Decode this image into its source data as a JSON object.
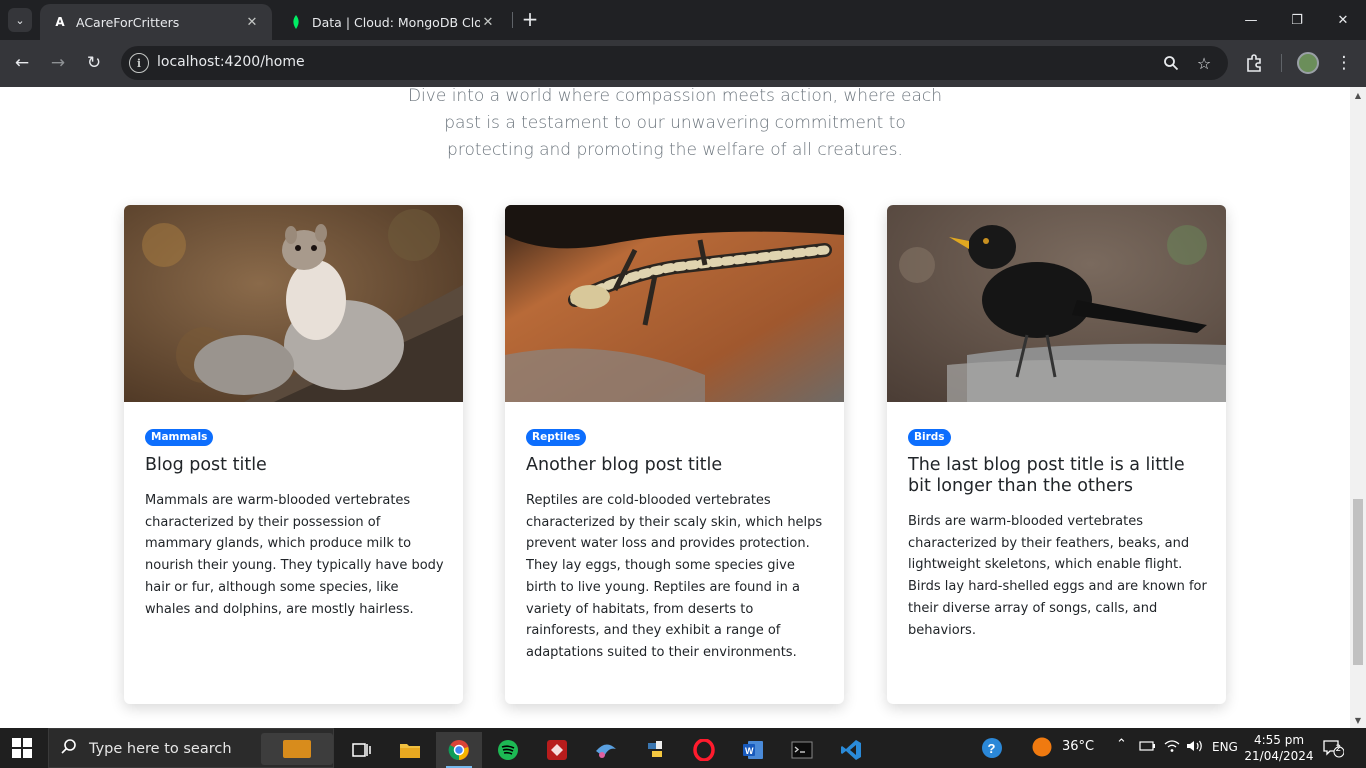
{
  "browser": {
    "tabs": [
      {
        "title": "ACareForCritters",
        "active": true
      },
      {
        "title": "Data | Cloud: MongoDB Cloud",
        "active": false
      }
    ],
    "url": "localhost:4200/home"
  },
  "page": {
    "intro": "Dive into a world where compassion meets action, where each past is a testament to our unwavering commitment to protecting and promoting the welfare of all creatures.",
    "cards": [
      {
        "badge": "Mammals",
        "title": "Blog post title",
        "text": "Mammals are warm-blooded vertebrates characterized by their possession of mammary glands, which produce milk to nourish their young. They typically have body hair or fur, although some species, like whales and dolphins, are mostly hairless."
      },
      {
        "badge": "Reptiles",
        "title": "Another blog post title",
        "text": "Reptiles are cold-blooded vertebrates characterized by their scaly skin, which helps prevent water loss and provides protection. They lay eggs, though some species give birth to live young. Reptiles are found in a variety of habitats, from deserts to rainforests, and they exhibit a range of adaptations suited to their environments."
      },
      {
        "badge": "Birds",
        "title": "The last blog post title is a little bit longer than the others",
        "text": "Birds are warm-blooded vertebrates characterized by their feathers, beaks, and lightweight skeletons, which enable flight. Birds lay hard-shelled eggs and are known for their diverse array of songs, calls, and behaviors."
      }
    ]
  },
  "taskbar": {
    "search_placeholder": "Type here to search",
    "weather": "36°C",
    "language": "ENG",
    "time": "4:55 pm",
    "date": "21/04/2024",
    "notification_count": "2"
  },
  "colors": {
    "accent": "#0d6efd",
    "chrome_dark": "#202124",
    "chrome_toolbar": "#35363a"
  }
}
